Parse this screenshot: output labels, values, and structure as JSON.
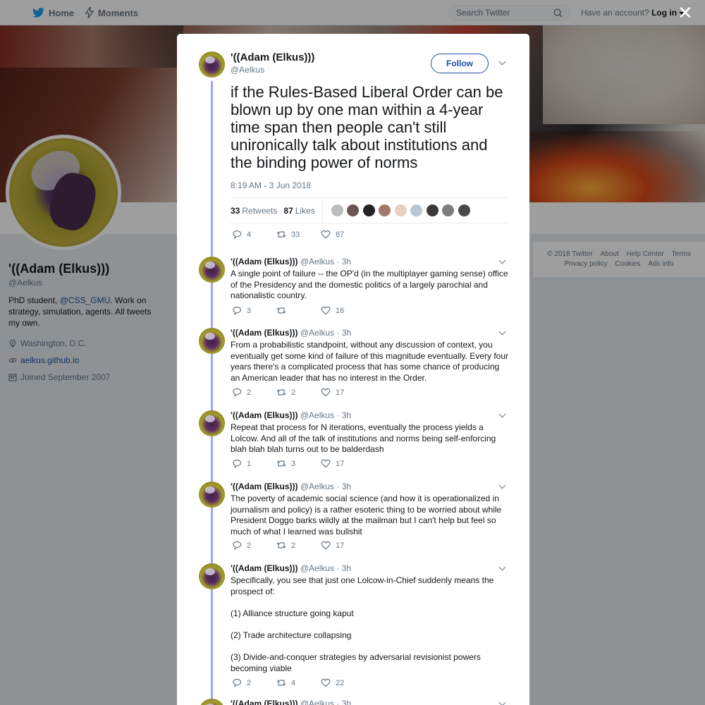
{
  "nav": {
    "home": "Home",
    "moments": "Moments",
    "search_placeholder": "Search Twitter",
    "have_account": "Have an account?",
    "login": "Log in"
  },
  "profile": {
    "name": "'((Adam (Elkus)))",
    "handle": "@Aelkus",
    "bio_prefix": "PhD student, ",
    "bio_link": "@CSS_GMU",
    "bio_suffix": ". Work on strategy, simulation, agents. All tweets my own.",
    "location": "Washington, D.C.",
    "website": "aelkus.github.io",
    "joined": "Joined September 2007"
  },
  "footer": {
    "copyright": "© 2018 Twitter",
    "about": "About",
    "help": "Help Center",
    "terms": "Terms",
    "privacy": "Privacy policy",
    "cookies": "Cookies",
    "ads": "Ads info"
  },
  "main_tweet": {
    "name": "'((Adam (Elkus)))",
    "handle": "@Aelkus",
    "follow_label": "Follow",
    "text": "if the Rules-Based Liberal Order can be blown up by one man within a 4-year time span then people can't still unironically talk about institutions and the binding power of norms",
    "time": "8:19 AM - 3 Jun 2018",
    "retweets_count": "33",
    "retweets_label": "Retweets",
    "likes_count": "87",
    "likes_label": "Likes",
    "likers": [
      "#bdbdbd",
      "#6b5552",
      "#232323",
      "#a4786a",
      "#e8cfbf",
      "#b9c6d2",
      "#3a3a3a",
      "#7d7d7d",
      "#4a4a4a"
    ],
    "replies": "4",
    "retweets": "33",
    "likes": "87"
  },
  "replies": [
    {
      "name": "'((Adam (Elkus)))",
      "handle": "@Aelkus",
      "time": "· 3h",
      "paragraphs": [
        "A single point of failure -- the OP'd (in the multiplayer gaming sense) office of the Presidency and the domestic politics of a largely parochial and nationalistic country."
      ],
      "replies": "3",
      "retweets": "",
      "likes": "16"
    },
    {
      "name": "'((Adam (Elkus)))",
      "handle": "@Aelkus",
      "time": "· 3h",
      "paragraphs": [
        "From a probabilistic standpoint, without any discussion of context, you eventually get some kind of failure of this magnitude eventually. Every four years there's a complicated process that has some chance of producing an American leader that has no interest in the Order."
      ],
      "replies": "2",
      "retweets": "2",
      "likes": "17"
    },
    {
      "name": "'((Adam (Elkus)))",
      "handle": "@Aelkus",
      "time": "· 3h",
      "paragraphs": [
        "Repeat that process for N iterations, eventually the process yields a Lolcow. And all of the talk of institutions and norms being self-enforcing blah blah blah turns out to be balderdash"
      ],
      "replies": "1",
      "retweets": "3",
      "likes": "17"
    },
    {
      "name": "'((Adam (Elkus)))",
      "handle": "@Aelkus",
      "time": "· 3h",
      "paragraphs": [
        "The poverty of academic social science (and how it is operationalized in journalism and policy) is a rather esoteric thing to be worried about while President Doggo barks wildly at the mailman but I can't help but feel so much of what I learned was bullshit"
      ],
      "replies": "2",
      "retweets": "2",
      "likes": "17"
    },
    {
      "name": "'((Adam (Elkus)))",
      "handle": "@Aelkus",
      "time": "· 3h",
      "paragraphs": [
        "Specifically, you see that just one Lolcow-in-Chief suddenly means the prospect of:",
        "(1) Alliance structure going kaput",
        "(2) Trade architecture collapsing",
        "(3) Divide-and-conquer strategies by adversarial revisionist powers becoming viable"
      ],
      "replies": "2",
      "retweets": "4",
      "likes": "22"
    },
    {
      "name": "'((Adam (Elkus)))",
      "handle": "@Aelkus",
      "time": "· 3h",
      "paragraphs": [],
      "replies": "",
      "retweets": "",
      "likes": ""
    }
  ]
}
